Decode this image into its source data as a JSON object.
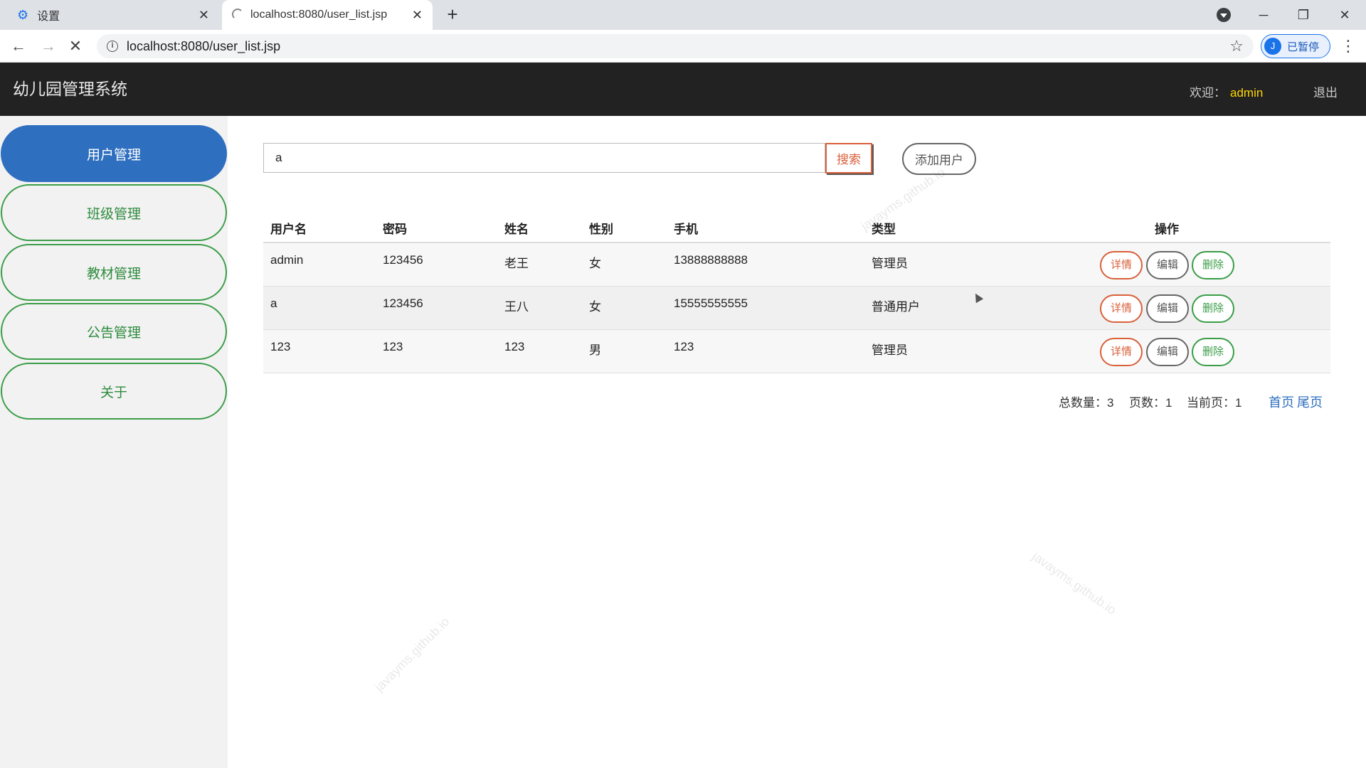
{
  "browser": {
    "tabs": [
      {
        "label": "设置",
        "icon": "gear-icon"
      },
      {
        "label": "localhost:8080/user_list.jsp",
        "icon": "loading-spinner-icon"
      }
    ],
    "url": "localhost:8080/user_list.jsp",
    "profile_status": "已暂停",
    "profile_initial": "J"
  },
  "header": {
    "title": "幼儿园管理系统",
    "welcome_label": "欢迎：",
    "username": "admin",
    "logout": "退出"
  },
  "sidebar": {
    "items": [
      {
        "label": "用户管理",
        "active": true
      },
      {
        "label": "班级管理",
        "active": false
      },
      {
        "label": "教材管理",
        "active": false
      },
      {
        "label": "公告管理",
        "active": false
      },
      {
        "label": "关于",
        "active": false
      }
    ]
  },
  "search": {
    "value": "a",
    "button": "搜索",
    "add_button": "添加用户"
  },
  "table": {
    "headers": [
      "用户名",
      "密码",
      "姓名",
      "性别",
      "手机",
      "类型",
      "操作"
    ],
    "rows": [
      {
        "username": "admin",
        "password": "123456",
        "name": "老王",
        "gender": "女",
        "phone": "13888888888",
        "type": "管理员"
      },
      {
        "username": "a",
        "password": "123456",
        "name": "王八",
        "gender": "女",
        "phone": "15555555555",
        "type": "普通用户"
      },
      {
        "username": "123",
        "password": "123",
        "name": "123",
        "gender": "男",
        "phone": "123",
        "type": "管理员"
      }
    ],
    "actions": {
      "detail": "详情",
      "edit": "编辑",
      "delete": "删除"
    }
  },
  "pagination": {
    "total_label": "总数量：",
    "total": "3",
    "pages_label": "页数：",
    "pages": "1",
    "current_label": "当前页：",
    "current": "1",
    "first": "首页",
    "last": "尾页"
  },
  "watermark": "javayms.github.io",
  "colors": {
    "header_bg": "#222222",
    "active_nav": "#2f6fbf",
    "nav_border": "#3a9d47",
    "accent_red": "#d9603b",
    "username_yellow": "#ffd700"
  }
}
